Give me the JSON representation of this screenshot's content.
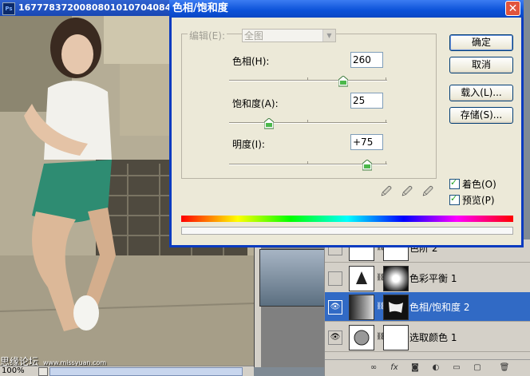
{
  "document": {
    "title": "1677783720080801010704084",
    "zoom": "100%",
    "watermark": "思缘论坛",
    "watermark_url": "www.missyuan.com"
  },
  "dialog": {
    "title": "色相/饱和度",
    "edit_label": "编辑(E):",
    "edit_value": "全图",
    "hue_label": "色相(H):",
    "hue_value": "260",
    "hue_position": 0.72,
    "saturation_label": "饱和度(A):",
    "saturation_value": "25",
    "saturation_position": 0.25,
    "lightness_label": "明度(I):",
    "lightness_value": "+75",
    "lightness_position": 0.875,
    "buttons": {
      "ok": "确定",
      "cancel": "取消",
      "load": "载入(L)...",
      "save": "存储(S)..."
    },
    "colorize_label": "着色(O)",
    "colorize_checked": true,
    "preview_label": "预览(P)",
    "preview_checked": true
  },
  "layers": {
    "items": [
      {
        "name": "色阶 2",
        "visible": false,
        "active": false
      },
      {
        "name": "色彩平衡 1",
        "visible": false,
        "active": false
      },
      {
        "name": "色相/饱和度 2",
        "visible": true,
        "active": true
      },
      {
        "name": "选取颜色 1",
        "visible": true,
        "active": false
      }
    ],
    "footer_icons": [
      "link-icon",
      "fx-icon",
      "mask-icon",
      "adjustment-icon",
      "group-icon",
      "new-layer-icon",
      "trash-icon"
    ]
  },
  "colors": {
    "titlebar": "#0b51d8",
    "active_layer": "#316ac5",
    "dialog_bg": "#ece9d8"
  }
}
